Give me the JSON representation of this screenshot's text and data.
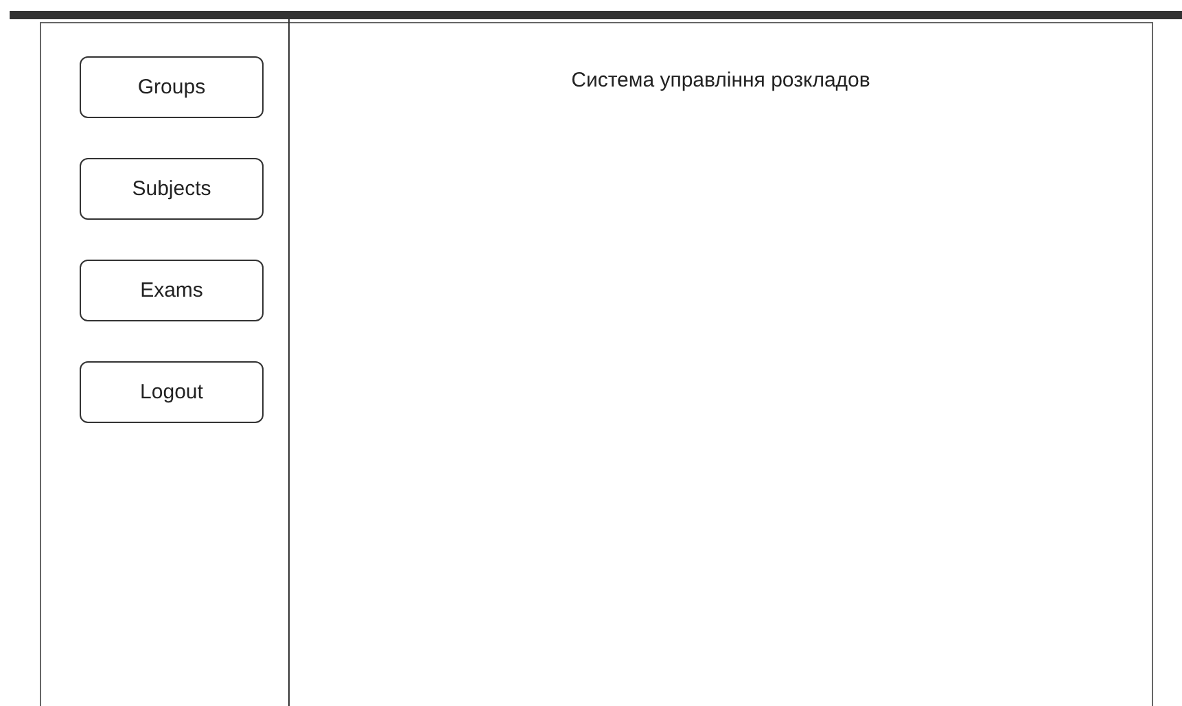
{
  "sidebar": {
    "buttons": [
      "Groups",
      "Subjects",
      "Exams",
      "Logout"
    ]
  },
  "main": {
    "title": "Система управління розкладов"
  }
}
